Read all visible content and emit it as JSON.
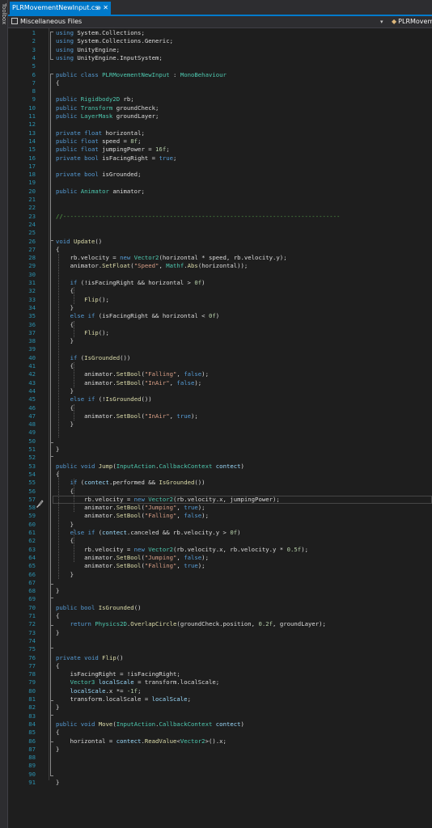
{
  "toolbox_label": "Toolbox",
  "tab": {
    "title": "PLRMovementNewInput.cs",
    "pin": "⊕",
    "close": "✕"
  },
  "navbar": {
    "left": "Miscellaneous Files",
    "right": "PLRMovemen"
  },
  "code_lines": [
    [
      [
        "k",
        "using"
      ],
      [
        "f",
        " System.Collections;"
      ]
    ],
    [
      [
        "k",
        "using"
      ],
      [
        "f",
        " System.Collections.Generic;"
      ]
    ],
    [
      [
        "k",
        "using"
      ],
      [
        "f",
        " UnityEngine;"
      ]
    ],
    [
      [
        "k",
        "using"
      ],
      [
        "f",
        " UnityEngine.InputSystem;"
      ]
    ],
    [],
    [
      [
        "k",
        "public"
      ],
      [
        "f",
        " "
      ],
      [
        "k",
        "class"
      ],
      [
        "f",
        " "
      ],
      [
        "t",
        "PLRMovementNewInput"
      ],
      [
        "f",
        " : "
      ],
      [
        "t",
        "MonoBehaviour"
      ]
    ],
    [
      [
        "f",
        "{"
      ]
    ],
    [],
    [
      [
        "k",
        "public"
      ],
      [
        "f",
        " "
      ],
      [
        "t",
        "Rigidbody2D"
      ],
      [
        "f",
        " rb;"
      ]
    ],
    [
      [
        "k",
        "public"
      ],
      [
        "f",
        " "
      ],
      [
        "t",
        "Transform"
      ],
      [
        "f",
        " groundCheck;"
      ]
    ],
    [
      [
        "k",
        "public"
      ],
      [
        "f",
        " "
      ],
      [
        "t",
        "LayerMask"
      ],
      [
        "f",
        " groundLayer;"
      ]
    ],
    [],
    [
      [
        "k",
        "private"
      ],
      [
        "f",
        " "
      ],
      [
        "k",
        "float"
      ],
      [
        "f",
        " horizontal;"
      ]
    ],
    [
      [
        "k",
        "public"
      ],
      [
        "f",
        " "
      ],
      [
        "k",
        "float"
      ],
      [
        "f",
        " speed = "
      ],
      [
        "n",
        "8f"
      ],
      [
        "f",
        ";"
      ]
    ],
    [
      [
        "k",
        "public"
      ],
      [
        "f",
        " "
      ],
      [
        "k",
        "float"
      ],
      [
        "f",
        " jumpingPower = "
      ],
      [
        "n",
        "16f"
      ],
      [
        "f",
        ";"
      ]
    ],
    [
      [
        "k",
        "private"
      ],
      [
        "f",
        " "
      ],
      [
        "k",
        "bool"
      ],
      [
        "f",
        " isFacingRight = "
      ],
      [
        "k",
        "true"
      ],
      [
        "f",
        ";"
      ]
    ],
    [],
    [
      [
        "k",
        "private"
      ],
      [
        "f",
        " "
      ],
      [
        "k",
        "bool"
      ],
      [
        "f",
        " isGrounded;"
      ]
    ],
    [],
    [
      [
        "k",
        "public"
      ],
      [
        "f",
        " "
      ],
      [
        "t",
        "Animator"
      ],
      [
        "f",
        " animator;"
      ]
    ],
    [],
    [],
    [
      [
        "c",
        "//------------------------------------------------------------------------------"
      ]
    ],
    [],
    [],
    [
      [
        "k",
        "void"
      ],
      [
        "f",
        " "
      ],
      [
        "m",
        "Update"
      ],
      [
        "f",
        "()"
      ]
    ],
    [
      [
        "f",
        "{"
      ]
    ],
    [
      [
        "f",
        "    rb.velocity = "
      ],
      [
        "k",
        "new"
      ],
      [
        "f",
        " "
      ],
      [
        "t",
        "Vector2"
      ],
      [
        "f",
        "(horizontal * speed, rb.velocity.y);"
      ]
    ],
    [
      [
        "f",
        "    animator."
      ],
      [
        "m",
        "SetFloat"
      ],
      [
        "f",
        "("
      ],
      [
        "s",
        "\"Speed\""
      ],
      [
        "f",
        ", "
      ],
      [
        "t",
        "Mathf"
      ],
      [
        "f",
        "."
      ],
      [
        "m",
        "Abs"
      ],
      [
        "f",
        "(horizontal));"
      ]
    ],
    [],
    [
      [
        "f",
        "    "
      ],
      [
        "k",
        "if"
      ],
      [
        "f",
        " (!isFacingRight && horizontal > "
      ],
      [
        "n",
        "0f"
      ],
      [
        "f",
        ")"
      ]
    ],
    [
      [
        "f",
        "    {"
      ]
    ],
    [
      [
        "f",
        "        "
      ],
      [
        "m",
        "Flip"
      ],
      [
        "f",
        "();"
      ]
    ],
    [
      [
        "f",
        "    }"
      ]
    ],
    [
      [
        "f",
        "    "
      ],
      [
        "k",
        "else"
      ],
      [
        "f",
        " "
      ],
      [
        "k",
        "if"
      ],
      [
        "f",
        " (isFacingRight && horizontal < "
      ],
      [
        "n",
        "0f"
      ],
      [
        "f",
        ")"
      ]
    ],
    [
      [
        "f",
        "    {"
      ]
    ],
    [
      [
        "f",
        "        "
      ],
      [
        "m",
        "Flip"
      ],
      [
        "f",
        "();"
      ]
    ],
    [
      [
        "f",
        "    }"
      ]
    ],
    [],
    [
      [
        "f",
        "    "
      ],
      [
        "k",
        "if"
      ],
      [
        "f",
        " ("
      ],
      [
        "m",
        "IsGrounded"
      ],
      [
        "f",
        "())"
      ]
    ],
    [
      [
        "f",
        "    {"
      ]
    ],
    [
      [
        "f",
        "        animator."
      ],
      [
        "m",
        "SetBool"
      ],
      [
        "f",
        "("
      ],
      [
        "s",
        "\"Falling\""
      ],
      [
        "f",
        ", "
      ],
      [
        "k",
        "false"
      ],
      [
        "f",
        ");"
      ]
    ],
    [
      [
        "f",
        "        animator."
      ],
      [
        "m",
        "SetBool"
      ],
      [
        "f",
        "("
      ],
      [
        "s",
        "\"InAir\""
      ],
      [
        "f",
        ", "
      ],
      [
        "k",
        "false"
      ],
      [
        "f",
        ");"
      ]
    ],
    [
      [
        "f",
        "    }"
      ]
    ],
    [
      [
        "f",
        "    "
      ],
      [
        "k",
        "else"
      ],
      [
        "f",
        " "
      ],
      [
        "k",
        "if"
      ],
      [
        "f",
        " (!"
      ],
      [
        "m",
        "IsGrounded"
      ],
      [
        "f",
        "())"
      ]
    ],
    [
      [
        "f",
        "    {"
      ]
    ],
    [
      [
        "f",
        "        animator."
      ],
      [
        "m",
        "SetBool"
      ],
      [
        "f",
        "("
      ],
      [
        "s",
        "\"InAir\""
      ],
      [
        "f",
        ", "
      ],
      [
        "k",
        "true"
      ],
      [
        "f",
        ");"
      ]
    ],
    [
      [
        "f",
        "    }"
      ]
    ],
    [],
    [],
    [
      [
        "f",
        "}"
      ]
    ],
    [],
    [
      [
        "k",
        "public"
      ],
      [
        "f",
        " "
      ],
      [
        "k",
        "void"
      ],
      [
        "f",
        " "
      ],
      [
        "m",
        "Jump"
      ],
      [
        "f",
        "("
      ],
      [
        "t",
        "InputAction"
      ],
      [
        "f",
        "."
      ],
      [
        "t",
        "CallbackContext"
      ],
      [
        "f",
        " "
      ],
      [
        "p",
        "contect"
      ],
      [
        "f",
        ")"
      ]
    ],
    [
      [
        "f",
        "{"
      ]
    ],
    [
      [
        "f",
        "    "
      ],
      [
        "k",
        "if"
      ],
      [
        "f",
        " ("
      ],
      [
        "p",
        "contect"
      ],
      [
        "f",
        ".performed && "
      ],
      [
        "m",
        "IsGrounded"
      ],
      [
        "f",
        "())"
      ]
    ],
    [
      [
        "f",
        "    {"
      ]
    ],
    [
      [
        "f",
        "        rb.velocity = "
      ],
      [
        "k",
        "new"
      ],
      [
        "f",
        " "
      ],
      [
        "t",
        "Vector2"
      ],
      [
        "f",
        "(rb.velocity.x, jumpingPower);"
      ]
    ],
    [
      [
        "f",
        "        animator."
      ],
      [
        "m",
        "SetBool"
      ],
      [
        "f",
        "("
      ],
      [
        "s",
        "\"Jumping\""
      ],
      [
        "f",
        ", "
      ],
      [
        "k",
        "true"
      ],
      [
        "f",
        ");"
      ]
    ],
    [
      [
        "f",
        "        animator."
      ],
      [
        "m",
        "SetBool"
      ],
      [
        "f",
        "("
      ],
      [
        "s",
        "\"Falling\""
      ],
      [
        "f",
        ", "
      ],
      [
        "k",
        "false"
      ],
      [
        "f",
        ");"
      ]
    ],
    [
      [
        "f",
        "    }"
      ]
    ],
    [
      [
        "f",
        "    "
      ],
      [
        "k",
        "else"
      ],
      [
        "f",
        " "
      ],
      [
        "k",
        "if"
      ],
      [
        "f",
        " ("
      ],
      [
        "p",
        "contect"
      ],
      [
        "f",
        ".canceled && rb.velocity.y > "
      ],
      [
        "n",
        "0f"
      ],
      [
        "f",
        ")"
      ]
    ],
    [
      [
        "f",
        "    {"
      ]
    ],
    [
      [
        "f",
        "        rb.velocity = "
      ],
      [
        "k",
        "new"
      ],
      [
        "f",
        " "
      ],
      [
        "t",
        "Vector2"
      ],
      [
        "f",
        "(rb.velocity.x, rb.velocity.y * "
      ],
      [
        "n",
        "0.5f"
      ],
      [
        "f",
        ");"
      ]
    ],
    [
      [
        "f",
        "        animator."
      ],
      [
        "m",
        "SetBool"
      ],
      [
        "f",
        "("
      ],
      [
        "s",
        "\"Jumping\""
      ],
      [
        "f",
        ", "
      ],
      [
        "k",
        "false"
      ],
      [
        "f",
        ");"
      ]
    ],
    [
      [
        "f",
        "        animator."
      ],
      [
        "m",
        "SetBool"
      ],
      [
        "f",
        "("
      ],
      [
        "s",
        "\"Falling\""
      ],
      [
        "f",
        ", "
      ],
      [
        "k",
        "true"
      ],
      [
        "f",
        ");"
      ]
    ],
    [
      [
        "f",
        "    }"
      ]
    ],
    [],
    [
      [
        "f",
        "}"
      ]
    ],
    [],
    [
      [
        "k",
        "public"
      ],
      [
        "f",
        " "
      ],
      [
        "k",
        "bool"
      ],
      [
        "f",
        " "
      ],
      [
        "m",
        "IsGrounded"
      ],
      [
        "f",
        "()"
      ]
    ],
    [
      [
        "f",
        "{"
      ]
    ],
    [
      [
        "f",
        "    "
      ],
      [
        "k",
        "return"
      ],
      [
        "f",
        " "
      ],
      [
        "t",
        "Physics2D"
      ],
      [
        "f",
        "."
      ],
      [
        "m",
        "OverlapCircle"
      ],
      [
        "f",
        "(groundCheck.position, "
      ],
      [
        "n",
        "0.2f"
      ],
      [
        "f",
        ", groundLayer);"
      ]
    ],
    [
      [
        "f",
        "}"
      ]
    ],
    [],
    [],
    [
      [
        "k",
        "private"
      ],
      [
        "f",
        " "
      ],
      [
        "k",
        "void"
      ],
      [
        "f",
        " "
      ],
      [
        "m",
        "Flip"
      ],
      [
        "f",
        "()"
      ]
    ],
    [
      [
        "f",
        "{"
      ]
    ],
    [
      [
        "f",
        "    isFacingRight = !isFacingRight;"
      ]
    ],
    [
      [
        "f",
        "    "
      ],
      [
        "t",
        "Vector3"
      ],
      [
        "f",
        " "
      ],
      [
        "p",
        "localScale"
      ],
      [
        "f",
        " = transform.localScale;"
      ]
    ],
    [
      [
        "f",
        "    "
      ],
      [
        "p",
        "localScale"
      ],
      [
        "f",
        ".x *= "
      ],
      [
        "n",
        "-1f"
      ],
      [
        "f",
        ";"
      ]
    ],
    [
      [
        "f",
        "    transform.localScale = "
      ],
      [
        "p",
        "localScale"
      ],
      [
        "f",
        ";"
      ]
    ],
    [
      [
        "f",
        "}"
      ]
    ],
    [],
    [
      [
        "k",
        "public"
      ],
      [
        "f",
        " "
      ],
      [
        "k",
        "void"
      ],
      [
        "f",
        " "
      ],
      [
        "m",
        "Move"
      ],
      [
        "f",
        "("
      ],
      [
        "t",
        "InputAction"
      ],
      [
        "f",
        "."
      ],
      [
        "t",
        "CallbackContext"
      ],
      [
        "f",
        " "
      ],
      [
        "p",
        "contect"
      ],
      [
        "f",
        ")"
      ]
    ],
    [
      [
        "f",
        "{"
      ]
    ],
    [
      [
        "f",
        "    horizontal = "
      ],
      [
        "p",
        "contect"
      ],
      [
        "f",
        "."
      ],
      [
        "m",
        "ReadValue"
      ],
      [
        "f",
        "<"
      ],
      [
        "t",
        "Vector2"
      ],
      [
        "f",
        ">().x;"
      ]
    ],
    [
      [
        "f",
        "}"
      ]
    ],
    [],
    [],
    [],
    [
      [
        "f",
        "}"
      ]
    ]
  ],
  "active_line": 57
}
